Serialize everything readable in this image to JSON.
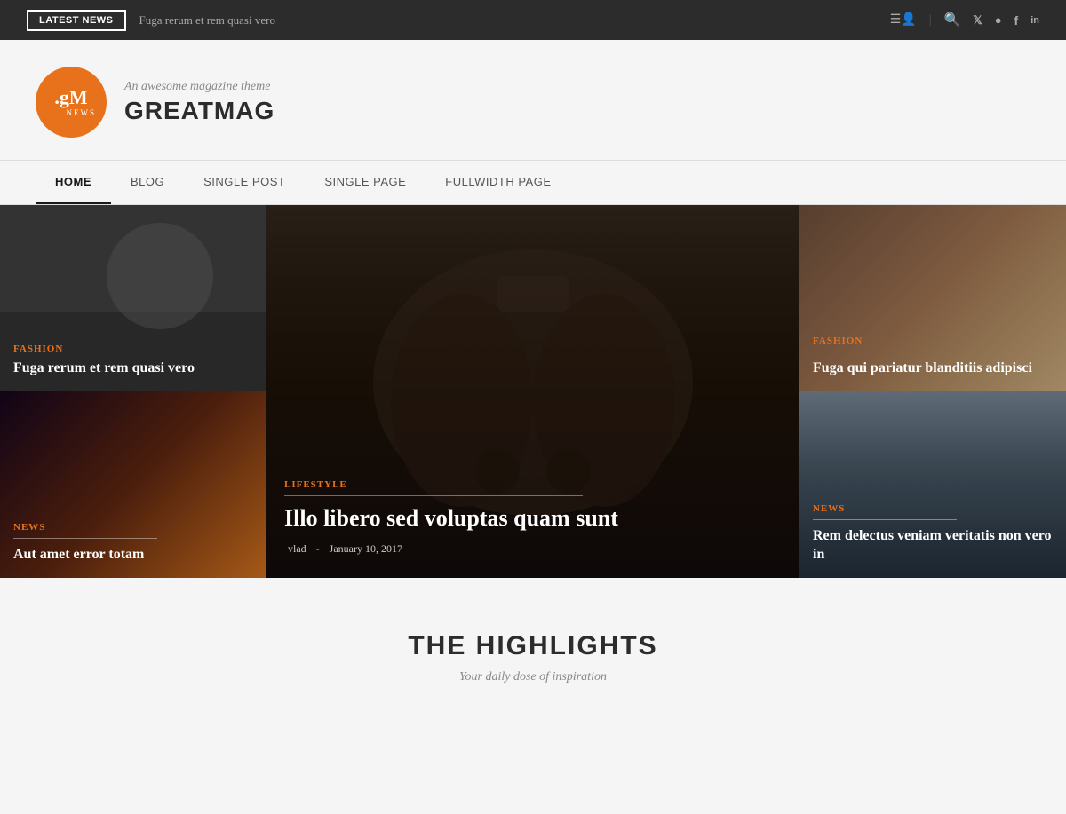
{
  "topbar": {
    "latest_news_label": "LATEST NEWS",
    "ticker_text": "Fuga rerum et rem quasi vero"
  },
  "header": {
    "logo_gm": ".gM",
    "logo_news": "NEWS",
    "tagline": "An awesome magazine theme",
    "site_name": "GREATMAG"
  },
  "nav": {
    "items": [
      {
        "label": "HOME",
        "active": true
      },
      {
        "label": "BLOG",
        "active": false
      },
      {
        "label": "SINGLE POST",
        "active": false
      },
      {
        "label": "SINGLE PAGE",
        "active": false
      },
      {
        "label": "FULLWIDTH PAGE",
        "active": false
      }
    ]
  },
  "hero": {
    "left_top": {
      "category": "FASHION",
      "title": "Fuga rerum et rem quasi vero"
    },
    "left_bottom": {
      "category": "NEWS",
      "title": "Aut amet error totam"
    },
    "center": {
      "category": "LIFESTYLE",
      "title": "Illo libero sed voluptas quam sunt",
      "author": "vlad",
      "date": "January 10, 2017"
    },
    "right_top": {
      "category": "FASHION",
      "title": "Fuga qui pariatur blanditiis adipisci"
    },
    "right_bottom": {
      "category": "NEWS",
      "title": "Rem delectus veniam veritatis non vero in"
    }
  },
  "highlights": {
    "title": "THE HIGHLIGHTS",
    "subtitle": "Your daily dose of inspiration"
  },
  "icons": {
    "user": "👤",
    "search": "⌕",
    "twitter": "𝕏",
    "instagram": "◎",
    "facebook": "f",
    "linkedin": "in"
  }
}
